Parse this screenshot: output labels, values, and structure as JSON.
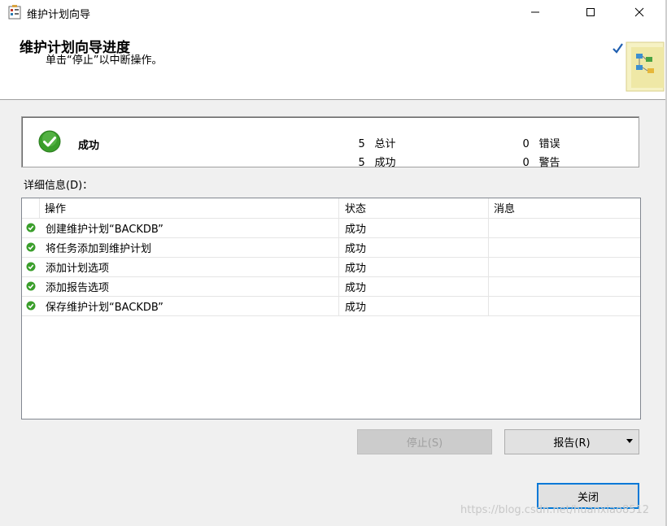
{
  "window": {
    "title": "维护计划向导",
    "controls": [
      "minimize",
      "maximize",
      "close"
    ]
  },
  "header": {
    "title": "维护计划向导进度",
    "subtitle": "单击“停止”以中断操作。"
  },
  "summary": {
    "status": "成功",
    "total_num": "5",
    "total_label": "总计",
    "success_num": "5",
    "success_label": "成功",
    "error_num": "0",
    "error_label": "错误",
    "warning_num": "0",
    "warning_label": "警告"
  },
  "details": {
    "label": "详细信息(D)：",
    "columns": [
      "操作",
      "状态",
      "消息"
    ],
    "rows": [
      {
        "action": "创建维护计划“BACKDB”",
        "status": "成功",
        "message": ""
      },
      {
        "action": "将任务添加到维护计划",
        "status": "成功",
        "message": ""
      },
      {
        "action": "添加计划选项",
        "status": "成功",
        "message": ""
      },
      {
        "action": "添加报告选项",
        "status": "成功",
        "message": ""
      },
      {
        "action": "保存维护计划“BACKDB”",
        "status": "成功",
        "message": ""
      }
    ]
  },
  "buttons": {
    "stop": "停止(S)",
    "report": "报告(R)",
    "close": "关闭"
  },
  "watermark": "https://blog.csdn.net/huanxiao8512",
  "colors": {
    "success_green": "#3a9e2b",
    "focus_blue": "#0078d7"
  }
}
